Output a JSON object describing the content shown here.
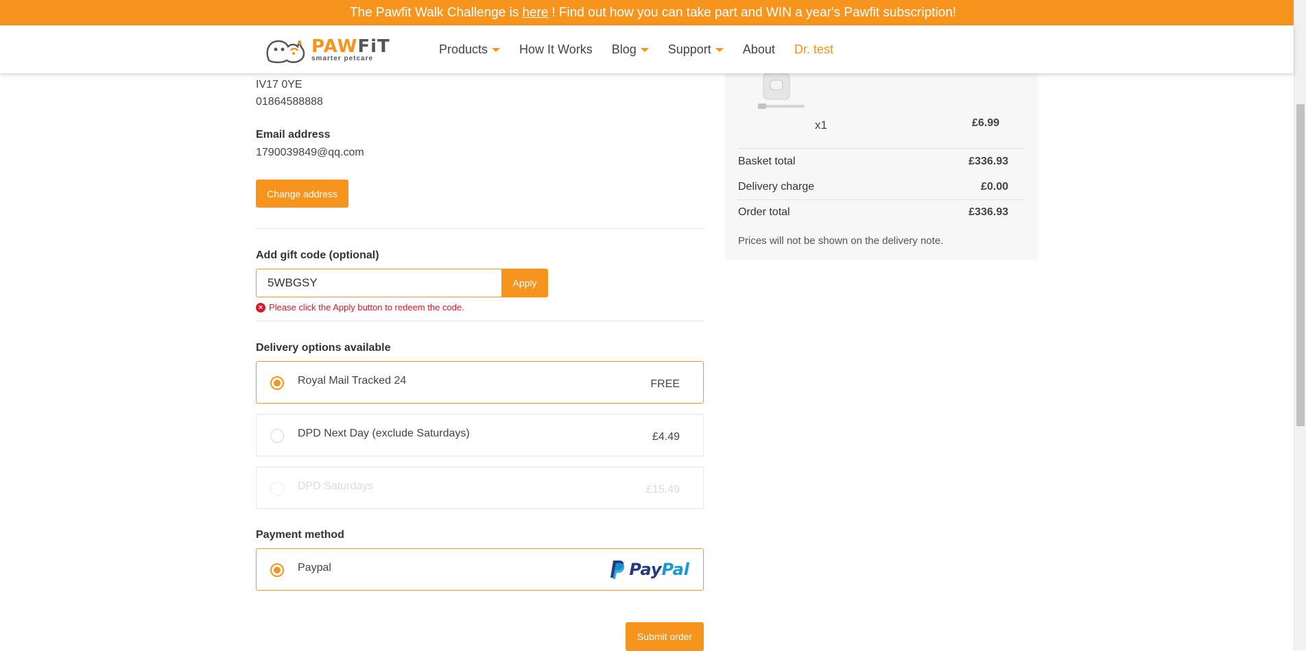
{
  "banner": {
    "text_before": "The Pawfit Walk Challenge is",
    "link": "here",
    "text_after": "! Find out how you can take part and WIN a year's Pawfit subscription!"
  },
  "header": {
    "logo_main_a": "PAW",
    "logo_main_b": "FiT",
    "logo_sub": "smarter petcare",
    "nav": [
      {
        "label": "Products"
      },
      {
        "label": "How It Works"
      },
      {
        "label": "Blog"
      },
      {
        "label": "Support"
      },
      {
        "label": "About"
      },
      {
        "label": "Dr. test"
      }
    ]
  },
  "address": {
    "postcode": "IV17 0YE",
    "phone": "01864588888",
    "email_label": "Email address",
    "email": "1790039849@qq.com",
    "change_button": "Change address"
  },
  "gift": {
    "label": "Add gift code (optional)",
    "value": "5WBGSY",
    "apply_button": "Apply",
    "error": "Please click the Apply button to redeem the code."
  },
  "delivery": {
    "label": "Delivery options available",
    "options": [
      {
        "name": "Royal Mail Tracked 24",
        "price": "FREE",
        "selected": true
      },
      {
        "name": "DPD Next Day (exclude Saturdays)",
        "price": "£4.49",
        "selected": false
      },
      {
        "name": "DPD Saturdays",
        "price": "£15.49",
        "selected": false,
        "disabled": true
      }
    ]
  },
  "payment": {
    "label": "Payment method",
    "option": "Paypal",
    "logo_pay": "Pay",
    "logo_pal": "Pal"
  },
  "submit_button": "Submit order",
  "summary": {
    "qty": "x1",
    "item_price": "£6.99",
    "basket_total_label": "Basket total",
    "basket_total": "£336.93",
    "delivery_label": "Delivery charge",
    "delivery_charge": "£0.00",
    "order_total_label": "Order total",
    "order_total": "£336.93",
    "note": "Prices will not be shown on the delivery note."
  },
  "colors": {
    "accent": "#f7941d",
    "error": "#e0142a",
    "paypal_dark": "#253b80",
    "paypal_light": "#179bd7"
  }
}
